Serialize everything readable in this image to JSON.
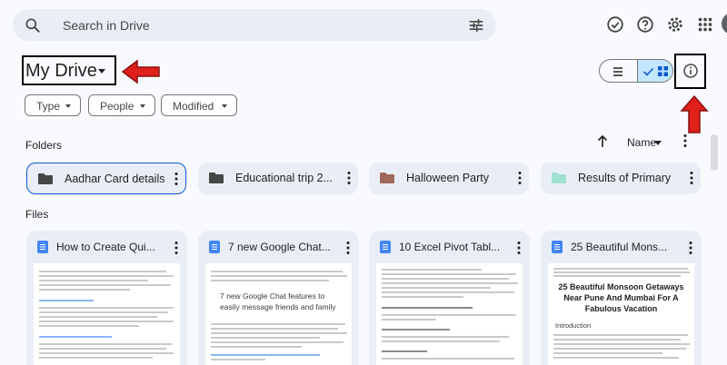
{
  "search": {
    "placeholder": "Search in Drive",
    "icon": "search-icon",
    "filter_icon": "tune-icon"
  },
  "top_icons": [
    "ready-offline-icon",
    "help-icon",
    "settings-icon",
    "apps-grid-icon"
  ],
  "page": {
    "title": "My Drive"
  },
  "view_toggle": {
    "list_icon": "list-view-icon",
    "grid_icon": "grid-view-icon",
    "selected": "grid"
  },
  "info_icon": "info-icon",
  "filters": [
    {
      "label": "Type"
    },
    {
      "label": "People"
    },
    {
      "label": "Modified"
    }
  ],
  "folders_section": {
    "label": "Folders",
    "sort_label": "Name"
  },
  "folders": [
    {
      "name": "Aadhar Card details",
      "color": "#444746",
      "selected": true
    },
    {
      "name": "Educational trip 2...",
      "color": "#444746",
      "selected": false
    },
    {
      "name": "Halloween Party",
      "color": "#a1675a",
      "selected": false
    },
    {
      "name": "Results of Primary",
      "color": "#9fe1cf",
      "selected": false
    }
  ],
  "files_section": {
    "label": "Files"
  },
  "files": [
    {
      "title": "How to Create Qui...",
      "preview_heading": ""
    },
    {
      "title": "7 new Google Chat...",
      "preview_heading": "7 new Google Chat features to easily message friends and family"
    },
    {
      "title": "10 Excel Pivot Tabl...",
      "preview_heading": ""
    },
    {
      "title": "25 Beautiful Mons...",
      "preview_heading": "25 Beautiful Monsoon Getaways Near Pune And Mumbai For A Fabulous Vacation",
      "preview_sub": "Introduction"
    }
  ],
  "annotation_color": "#e0201b"
}
